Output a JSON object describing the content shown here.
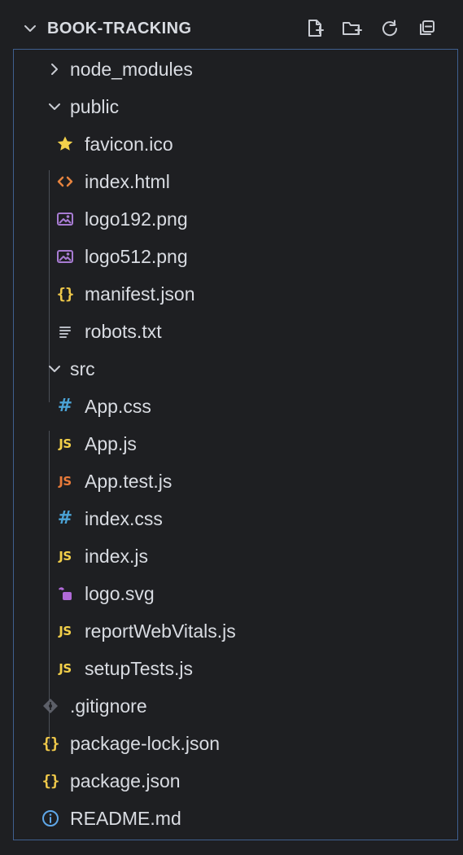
{
  "header": {
    "title": "BOOK-TRACKING",
    "actions": [
      {
        "name": "new-file-icon"
      },
      {
        "name": "new-folder-icon"
      },
      {
        "name": "refresh-icon"
      },
      {
        "name": "collapse-all-icon"
      }
    ]
  },
  "tree": {
    "items": [
      {
        "label": "node_modules",
        "icon": "chevron-right-icon"
      },
      {
        "label": "public",
        "icon": "chevron-down-icon"
      },
      {
        "label": "favicon.ico",
        "icon": "star-icon",
        "color": "#f2d14b"
      },
      {
        "label": "index.html",
        "icon": "html-icon",
        "color": "#e7843f"
      },
      {
        "label": "logo192.png",
        "icon": "image-icon",
        "color": "#a77bd2"
      },
      {
        "label": "logo512.png",
        "icon": "image-icon",
        "color": "#a77bd2"
      },
      {
        "label": "manifest.json",
        "icon": "json-icon",
        "color": "#f0c94a"
      },
      {
        "label": "robots.txt",
        "icon": "text-file-icon",
        "color": "#b8bcc4"
      },
      {
        "label": "src",
        "icon": "chevron-down-icon"
      },
      {
        "label": "App.css",
        "icon": "css-icon",
        "color": "#4ba3d6"
      },
      {
        "label": "App.js",
        "icon": "js-icon",
        "color": "#f3d04a"
      },
      {
        "label": "App.test.js",
        "icon": "js-test-icon",
        "color": "#e97b3a"
      },
      {
        "label": "index.css",
        "icon": "css-icon",
        "color": "#4ba3d6"
      },
      {
        "label": "index.js",
        "icon": "js-icon",
        "color": "#f3d04a"
      },
      {
        "label": "logo.svg",
        "icon": "svg-icon",
        "color": "#b06ad7"
      },
      {
        "label": "reportWebVitals.js",
        "icon": "js-icon",
        "color": "#f3d04a"
      },
      {
        "label": "setupTests.js",
        "icon": "js-icon",
        "color": "#f3d04a"
      },
      {
        "label": ".gitignore",
        "icon": "git-icon",
        "color": "#5c5f68"
      },
      {
        "label": "package-lock.json",
        "icon": "json-icon",
        "color": "#f0c94a"
      },
      {
        "label": "package.json",
        "icon": "json-icon",
        "color": "#f0c94a"
      },
      {
        "label": "README.md",
        "icon": "info-icon",
        "color": "#5fa7e8"
      }
    ],
    "icon_text": {
      "js": "JS",
      "css": "#",
      "json": "{}"
    }
  }
}
